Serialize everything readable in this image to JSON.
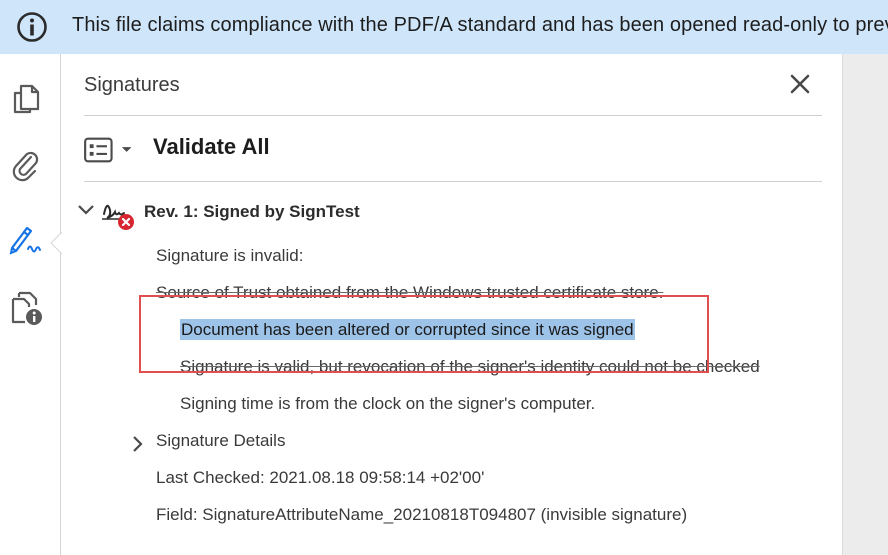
{
  "banner": {
    "text": "This file claims compliance with the PDF/A standard and has been opened read-only to prevent modification.",
    "icon": "info-icon"
  },
  "rail": {
    "items": [
      {
        "name": "pages",
        "icon": "pages-icon"
      },
      {
        "name": "attachments",
        "icon": "paperclip-icon"
      },
      {
        "name": "signatures",
        "icon": "signature-pen-icon",
        "active": true
      },
      {
        "name": "document-info",
        "icon": "document-info-icon"
      }
    ]
  },
  "panel": {
    "title": "Signatures",
    "close_icon": "close-icon",
    "validate_all": "Validate All",
    "options_icon": "list-options-icon"
  },
  "signature": {
    "revision_label": "Rev. 1: Signed by SignTest",
    "status_icon": "invalid-signature-icon",
    "status": "Signature is invalid:",
    "source_of_trust": "Source of Trust obtained from the Windows trusted certificate store.",
    "altered": "Document has been altered or corrupted since it was signed",
    "revocation": "Signature is valid, but revocation of the signer's identity could not be checked",
    "signing_time": "Signing time is from the clock on the signer's computer.",
    "details_label": "Signature Details",
    "last_checked": "Last Checked: 2021.08.18 09:58:14 +02'00'",
    "field": "Field: SignatureAttributeName_20210818T094807 (invisible signature)"
  },
  "colors": {
    "banner_bg": "#cfe6fa",
    "selection": "#9dc3e8",
    "annotation_box": "#e04f4f",
    "active_icon": "#1473e6"
  }
}
